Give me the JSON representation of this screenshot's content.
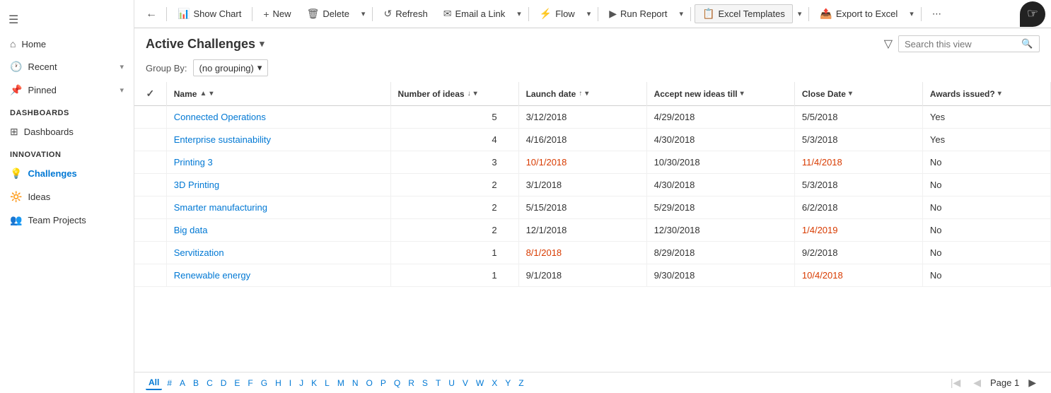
{
  "sidebar": {
    "hamburger": "☰",
    "back_icon": "←",
    "sections": [
      {
        "label": "",
        "items": [
          {
            "id": "home",
            "icon": "⌂",
            "label": "Home",
            "has_chevron": false
          },
          {
            "id": "recent",
            "icon": "🕐",
            "label": "Recent",
            "has_chevron": true
          },
          {
            "id": "pinned",
            "icon": "📌",
            "label": "Pinned",
            "has_chevron": true
          }
        ]
      },
      {
        "label": "Dashboards",
        "items": [
          {
            "id": "dashboards",
            "icon": "⊞",
            "label": "Dashboards",
            "has_chevron": false
          }
        ]
      },
      {
        "label": "Innovation",
        "items": [
          {
            "id": "challenges",
            "icon": "💡",
            "label": "Challenges",
            "has_chevron": false,
            "active": true
          },
          {
            "id": "ideas",
            "icon": "🔆",
            "label": "Ideas",
            "has_chevron": false
          },
          {
            "id": "team-projects",
            "icon": "👥",
            "label": "Team Projects",
            "has_chevron": false
          }
        ]
      }
    ]
  },
  "toolbar": {
    "back_label": "←",
    "show_chart_label": "Show Chart",
    "new_label": "New",
    "delete_label": "Delete",
    "refresh_label": "Refresh",
    "email_link_label": "Email a Link",
    "flow_label": "Flow",
    "run_report_label": "Run Report",
    "excel_templates_label": "Excel Templates",
    "export_excel_label": "Export to Excel",
    "more_label": "⋯"
  },
  "header": {
    "title": "Active Challenges",
    "search_placeholder": "Search this view",
    "filter_icon": "▽"
  },
  "group_by": {
    "label": "Group By:",
    "value": "(no grouping)"
  },
  "columns": [
    {
      "id": "check",
      "label": ""
    },
    {
      "id": "name",
      "label": "Name",
      "sort": "▲",
      "filter": "▾"
    },
    {
      "id": "number_of_ideas",
      "label": "Number of ideas",
      "sort": "↓",
      "filter": "▾"
    },
    {
      "id": "launch_date",
      "label": "Launch date",
      "sort": "↑",
      "filter": "▾"
    },
    {
      "id": "accept_new_ideas_till",
      "label": "Accept new ideas till",
      "sort": "",
      "filter": "▾"
    },
    {
      "id": "close_date",
      "label": "Close Date",
      "sort": "",
      "filter": "▾"
    },
    {
      "id": "awards_issued",
      "label": "Awards issued?",
      "sort": "",
      "filter": "▾"
    }
  ],
  "rows": [
    {
      "name": "Connected Operations",
      "name_color": "blue",
      "number_of_ideas": "5",
      "launch_date": "3/12/2018",
      "launch_date_color": "normal",
      "accept_new_ideas_till": "4/29/2018",
      "accept_new_ideas_till_color": "normal",
      "close_date": "5/5/2018",
      "close_date_color": "normal",
      "awards_issued": "Yes"
    },
    {
      "name": "Enterprise sustainability",
      "name_color": "blue",
      "number_of_ideas": "4",
      "launch_date": "4/16/2018",
      "launch_date_color": "normal",
      "accept_new_ideas_till": "4/30/2018",
      "accept_new_ideas_till_color": "normal",
      "close_date": "5/3/2018",
      "close_date_color": "normal",
      "awards_issued": "Yes"
    },
    {
      "name": "Printing 3",
      "name_color": "blue",
      "number_of_ideas": "3",
      "launch_date": "10/1/2018",
      "launch_date_color": "orange",
      "accept_new_ideas_till": "10/30/2018",
      "accept_new_ideas_till_color": "normal",
      "close_date": "11/4/2018",
      "close_date_color": "orange",
      "awards_issued": "No"
    },
    {
      "name": "3D Printing",
      "name_color": "blue",
      "number_of_ideas": "2",
      "launch_date": "3/1/2018",
      "launch_date_color": "normal",
      "accept_new_ideas_till": "4/30/2018",
      "accept_new_ideas_till_color": "normal",
      "close_date": "5/3/2018",
      "close_date_color": "normal",
      "awards_issued": "No"
    },
    {
      "name": "Smarter manufacturing",
      "name_color": "blue",
      "number_of_ideas": "2",
      "launch_date": "5/15/2018",
      "launch_date_color": "normal",
      "accept_new_ideas_till": "5/29/2018",
      "accept_new_ideas_till_color": "normal",
      "close_date": "6/2/2018",
      "close_date_color": "normal",
      "awards_issued": "No"
    },
    {
      "name": "Big data",
      "name_color": "blue",
      "number_of_ideas": "2",
      "launch_date": "12/1/2018",
      "launch_date_color": "normal",
      "accept_new_ideas_till": "12/30/2018",
      "accept_new_ideas_till_color": "normal",
      "close_date": "1/4/2019",
      "close_date_color": "orange",
      "awards_issued": "No"
    },
    {
      "name": "Servitization",
      "name_color": "blue",
      "number_of_ideas": "1",
      "launch_date": "8/1/2018",
      "launch_date_color": "orange",
      "accept_new_ideas_till": "8/29/2018",
      "accept_new_ideas_till_color": "normal",
      "close_date": "9/2/2018",
      "close_date_color": "normal",
      "awards_issued": "No"
    },
    {
      "name": "Renewable energy",
      "name_color": "blue",
      "number_of_ideas": "1",
      "launch_date": "9/1/2018",
      "launch_date_color": "normal",
      "accept_new_ideas_till": "9/30/2018",
      "accept_new_ideas_till_color": "normal",
      "close_date": "10/4/2018",
      "close_date_color": "orange",
      "awards_issued": "No"
    }
  ],
  "pagination": {
    "alpha": [
      "All",
      "#",
      "A",
      "B",
      "C",
      "D",
      "E",
      "F",
      "G",
      "H",
      "I",
      "J",
      "K",
      "L",
      "M",
      "N",
      "O",
      "P",
      "Q",
      "R",
      "S",
      "T",
      "U",
      "V",
      "W",
      "X",
      "Y",
      "Z"
    ],
    "active_alpha": "All",
    "page_label": "Page 1",
    "prev_disabled": true,
    "next_disabled": false
  },
  "colors": {
    "blue": "#0078d4",
    "orange": "#d83b01",
    "normal": "#333"
  }
}
